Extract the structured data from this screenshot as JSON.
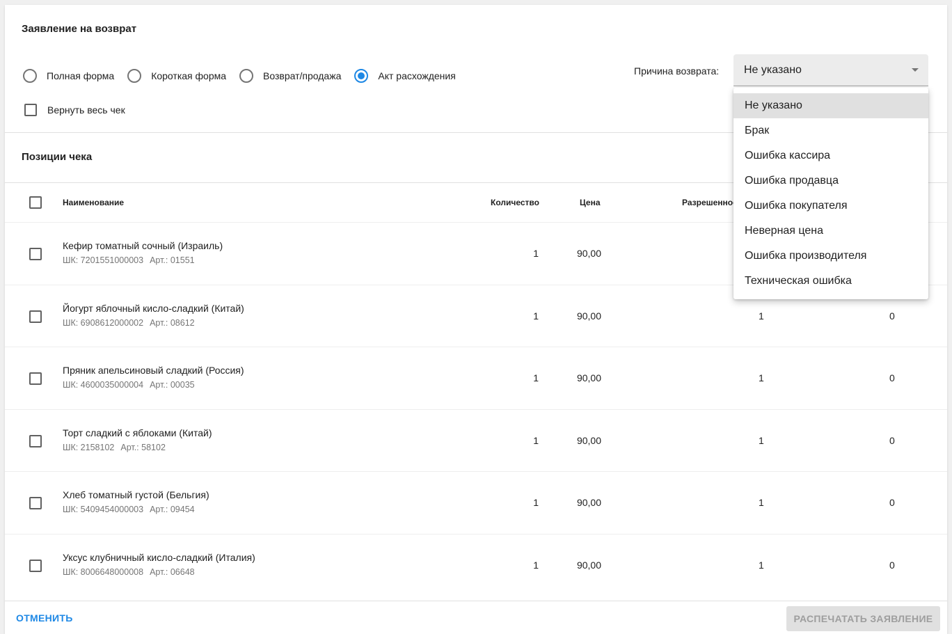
{
  "header": {
    "title": "Заявление на возврат"
  },
  "modes": [
    {
      "label": "Полная форма",
      "checked": false
    },
    {
      "label": "Короткая форма",
      "checked": false
    },
    {
      "label": "Возврат/продажа",
      "checked": false
    },
    {
      "label": "Акт расхождения",
      "checked": true
    }
  ],
  "whole_receipt": {
    "label": "Вернуть весь чек",
    "checked": false
  },
  "reason": {
    "label": "Причина возврата:",
    "value": "Не указано",
    "options": [
      "Не указано",
      "Брак",
      "Ошибка кассира",
      "Ошибка продавца",
      "Ошибка покупателя",
      "Неверная цена",
      "Ошибка производителя",
      "Техническая ошибка"
    ],
    "selected_index": 0
  },
  "positions": {
    "title": "Позиции чека",
    "columns": {
      "name": "Наименование",
      "quantity": "Количество",
      "price": "Цена",
      "allowed": "Разрешенное"
    },
    "rows": [
      {
        "name": "Кефир томатный сочный (Израиль)",
        "barcode": "ШК: 7201551000003",
        "article": "Арт.: 01551",
        "quantity": "1",
        "price": "90,00",
        "allowed": "",
        "returned": ""
      },
      {
        "name": "Йогурт яблочный кисло-сладкий (Китай)",
        "barcode": "ШК: 6908612000002",
        "article": "Арт.: 08612",
        "quantity": "1",
        "price": "90,00",
        "allowed": "1",
        "returned": "0"
      },
      {
        "name": "Пряник апельсиновый сладкий (Россия)",
        "barcode": "ШК: 4600035000004",
        "article": "Арт.: 00035",
        "quantity": "1",
        "price": "90,00",
        "allowed": "1",
        "returned": "0"
      },
      {
        "name": "Торт сладкий с яблоками (Китай)",
        "barcode": "ШК: 2158102",
        "article": "Арт.: 58102",
        "quantity": "1",
        "price": "90,00",
        "allowed": "1",
        "returned": "0"
      },
      {
        "name": "Хлеб томатный густой (Бельгия)",
        "barcode": "ШК: 5409454000003",
        "article": "Арт.: 09454",
        "quantity": "1",
        "price": "90,00",
        "allowed": "1",
        "returned": "0"
      },
      {
        "name": "Уксус клубничный кисло-сладкий (Италия)",
        "barcode": "ШК: 8006648000008",
        "article": "Арт.: 06648",
        "quantity": "1",
        "price": "90,00",
        "allowed": "1",
        "returned": "0"
      }
    ]
  },
  "footer": {
    "cancel_label": "ОТМЕНИТЬ",
    "print_label": "РАСПЕЧАТАТЬ ЗАЯВЛЕНИЕ"
  },
  "colors": {
    "accent": "#1e88e5",
    "disabled_bg": "#e0e0e0",
    "disabled_text": "#9e9e9e"
  },
  "icons": {
    "select_caret": "caret-down-icon"
  }
}
